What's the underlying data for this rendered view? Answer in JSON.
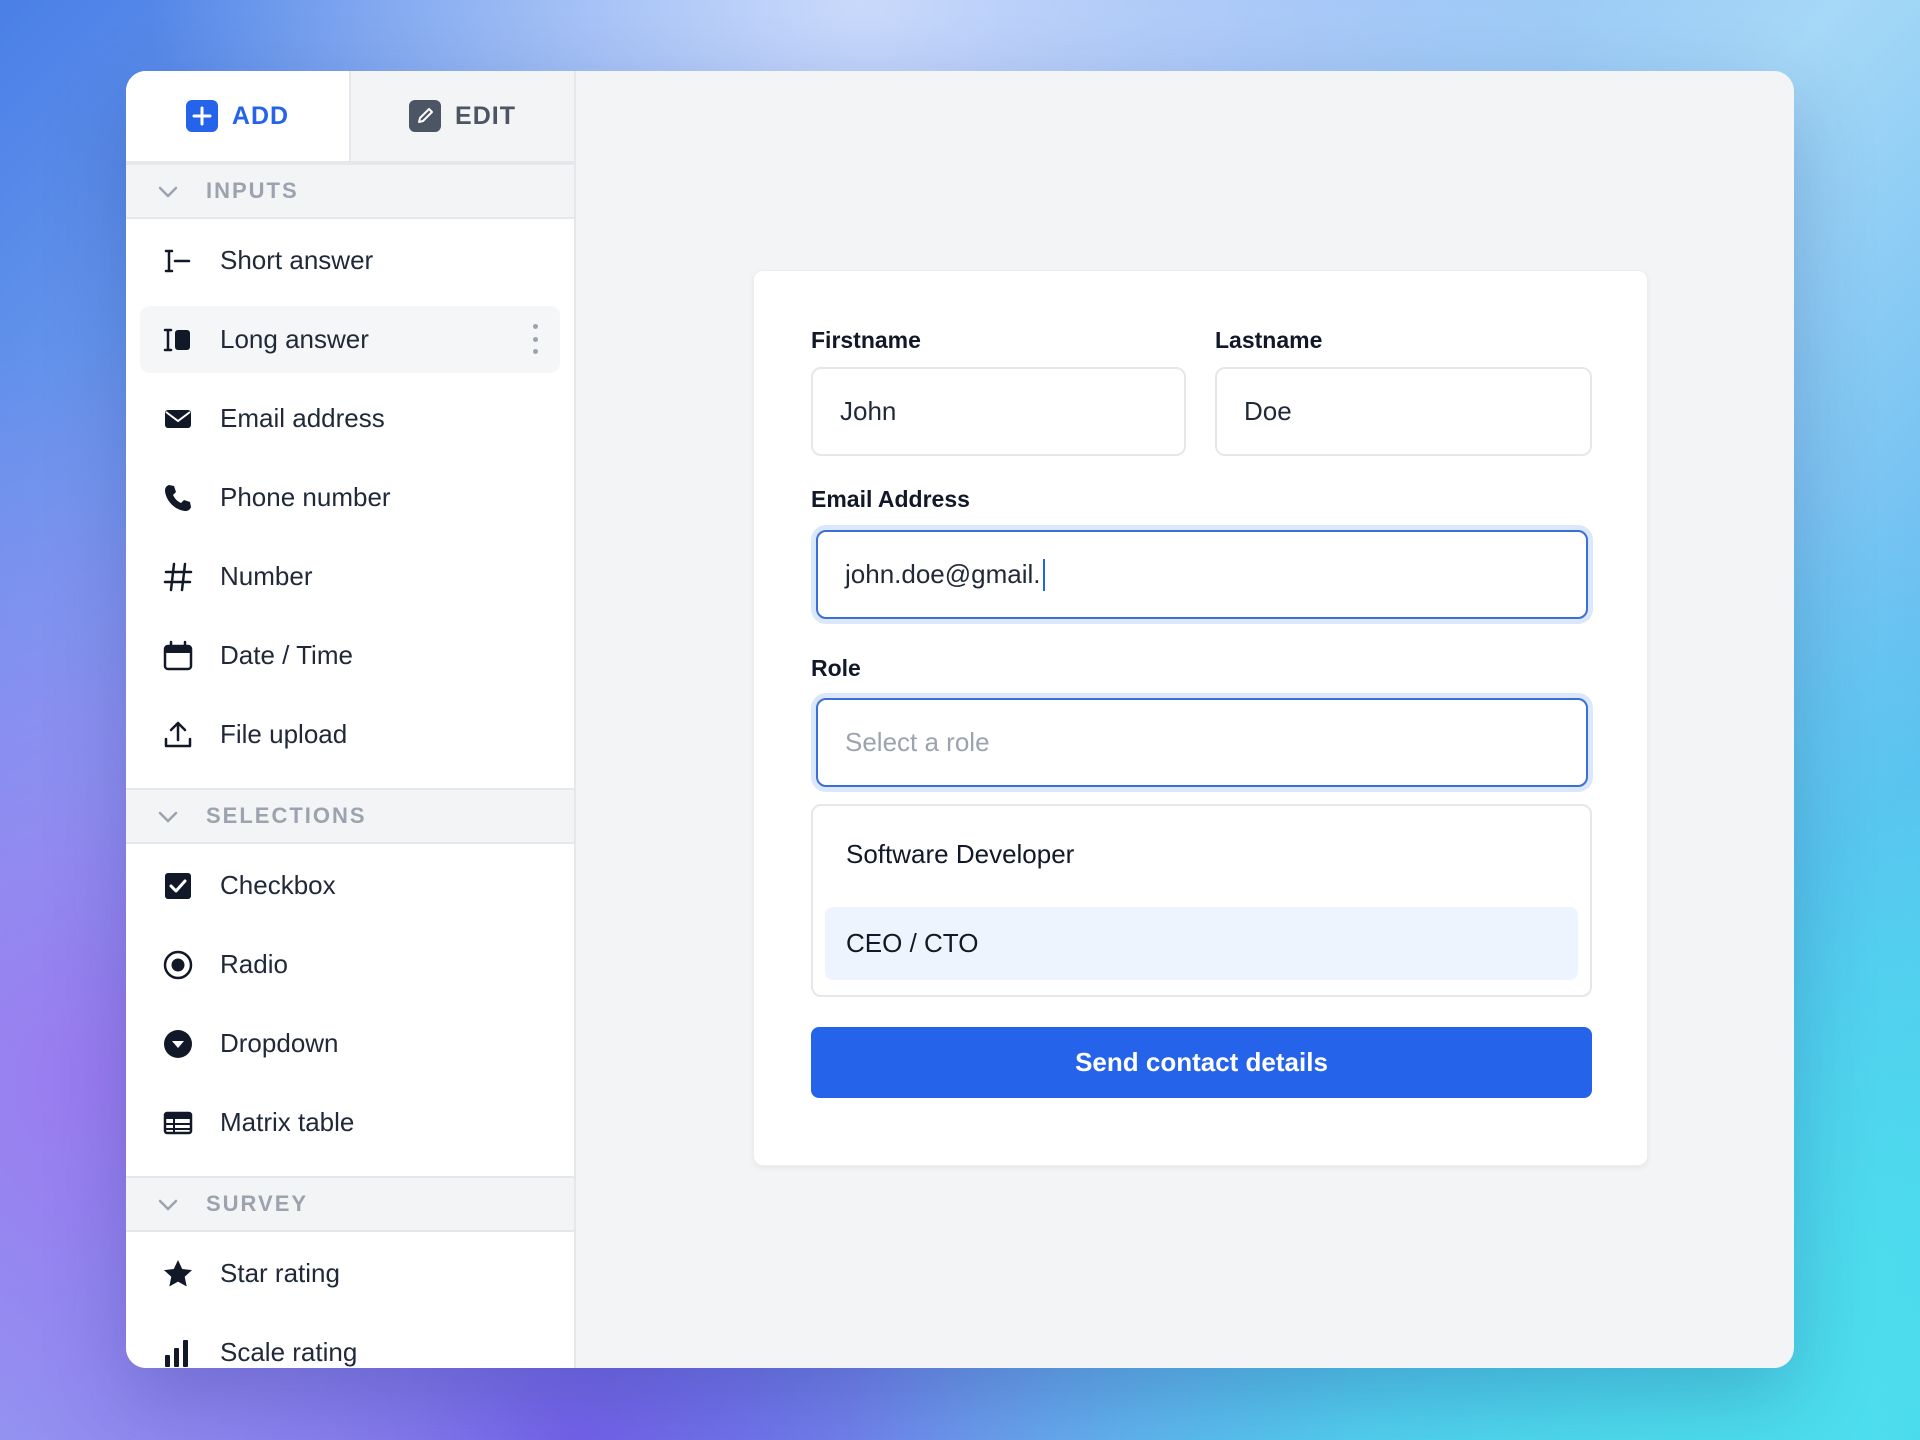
{
  "tabs": {
    "add": "ADD",
    "edit": "EDIT"
  },
  "sidebar": {
    "sections": [
      {
        "title": "INPUTS",
        "items": [
          {
            "label": "Short answer",
            "icon": "text-cursor-icon"
          },
          {
            "label": "Long answer",
            "icon": "text-block-icon"
          },
          {
            "label": "Email address",
            "icon": "envelope-icon"
          },
          {
            "label": "Phone number",
            "icon": "phone-icon"
          },
          {
            "label": "Number",
            "icon": "hash-icon"
          },
          {
            "label": "Date / Time",
            "icon": "calendar-icon"
          },
          {
            "label": "File upload",
            "icon": "upload-icon"
          }
        ]
      },
      {
        "title": "SELECTIONS",
        "items": [
          {
            "label": "Checkbox",
            "icon": "checkbox-icon"
          },
          {
            "label": "Radio",
            "icon": "radio-icon"
          },
          {
            "label": "Dropdown",
            "icon": "dropdown-icon"
          },
          {
            "label": "Matrix table",
            "icon": "table-icon"
          }
        ]
      },
      {
        "title": "SURVEY",
        "items": [
          {
            "label": "Star rating",
            "icon": "star-icon"
          },
          {
            "label": "Scale rating",
            "icon": "bar-chart-icon"
          }
        ]
      }
    ]
  },
  "form": {
    "firstname_label": "Firstname",
    "firstname_value": "John",
    "lastname_label": "Lastname",
    "lastname_value": "Doe",
    "email_label": "Email Address",
    "email_value": "john.doe@gmail.",
    "role_label": "Role",
    "role_placeholder": "Select a role",
    "role_options": [
      "Software Developer",
      "CEO / CTO"
    ],
    "submit_label": "Send contact details"
  },
  "colors": {
    "accent": "#2563eb",
    "focus_ring": "#dbe7fb",
    "option_highlight": "#eef4fd"
  }
}
